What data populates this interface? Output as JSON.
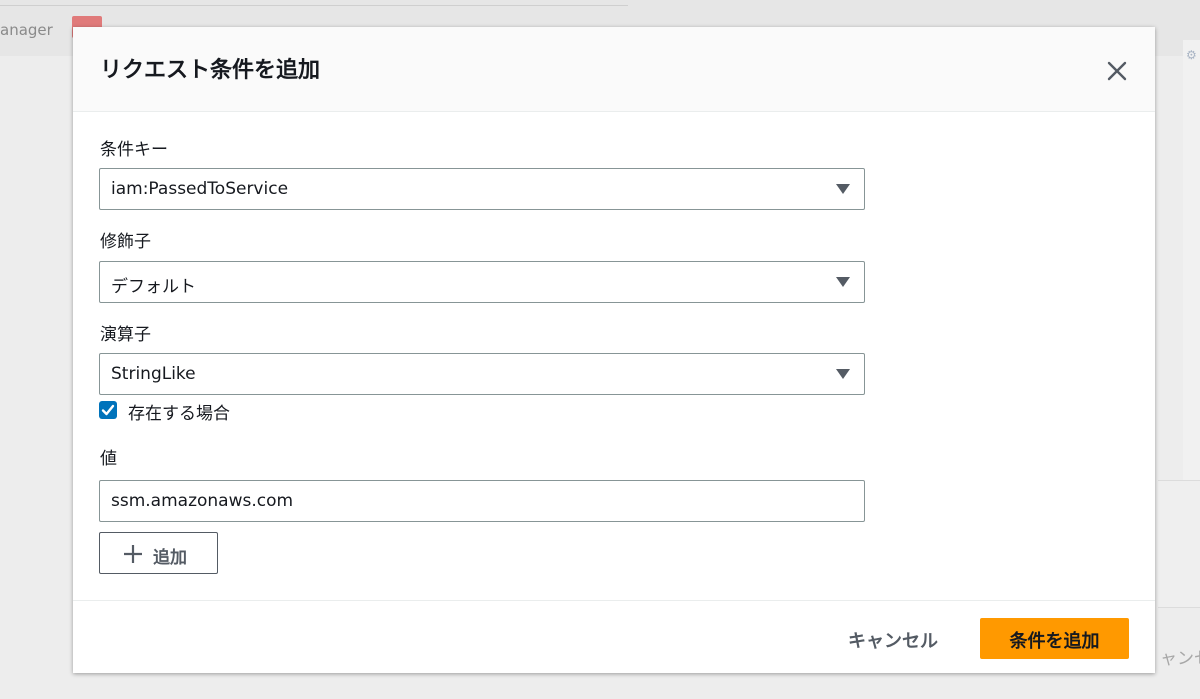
{
  "background": {
    "manager_text": "anager",
    "right_text": "ャンセ"
  },
  "modal": {
    "title": "リクエスト条件を追加",
    "close_icon": "close-icon"
  },
  "fields": {
    "condition_key": {
      "label": "条件キー",
      "value": "iam:PassedToService"
    },
    "qualifier": {
      "label": "修飾子",
      "value": "デフォルト"
    },
    "operator": {
      "label": "演算子",
      "value": "StringLike"
    },
    "if_exists": {
      "label": "存在する場合",
      "checked": true
    },
    "value": {
      "label": "値",
      "value": "ssm.amazonaws.com"
    }
  },
  "add_button": {
    "label": "追加",
    "icon": "plus-icon"
  },
  "footer": {
    "cancel_label": "キャンセル",
    "submit_label": "条件を追加"
  },
  "colors": {
    "primary_button": "#ff9900",
    "checkbox": "#0073bb",
    "text": "#16191f",
    "border": "#879596"
  }
}
